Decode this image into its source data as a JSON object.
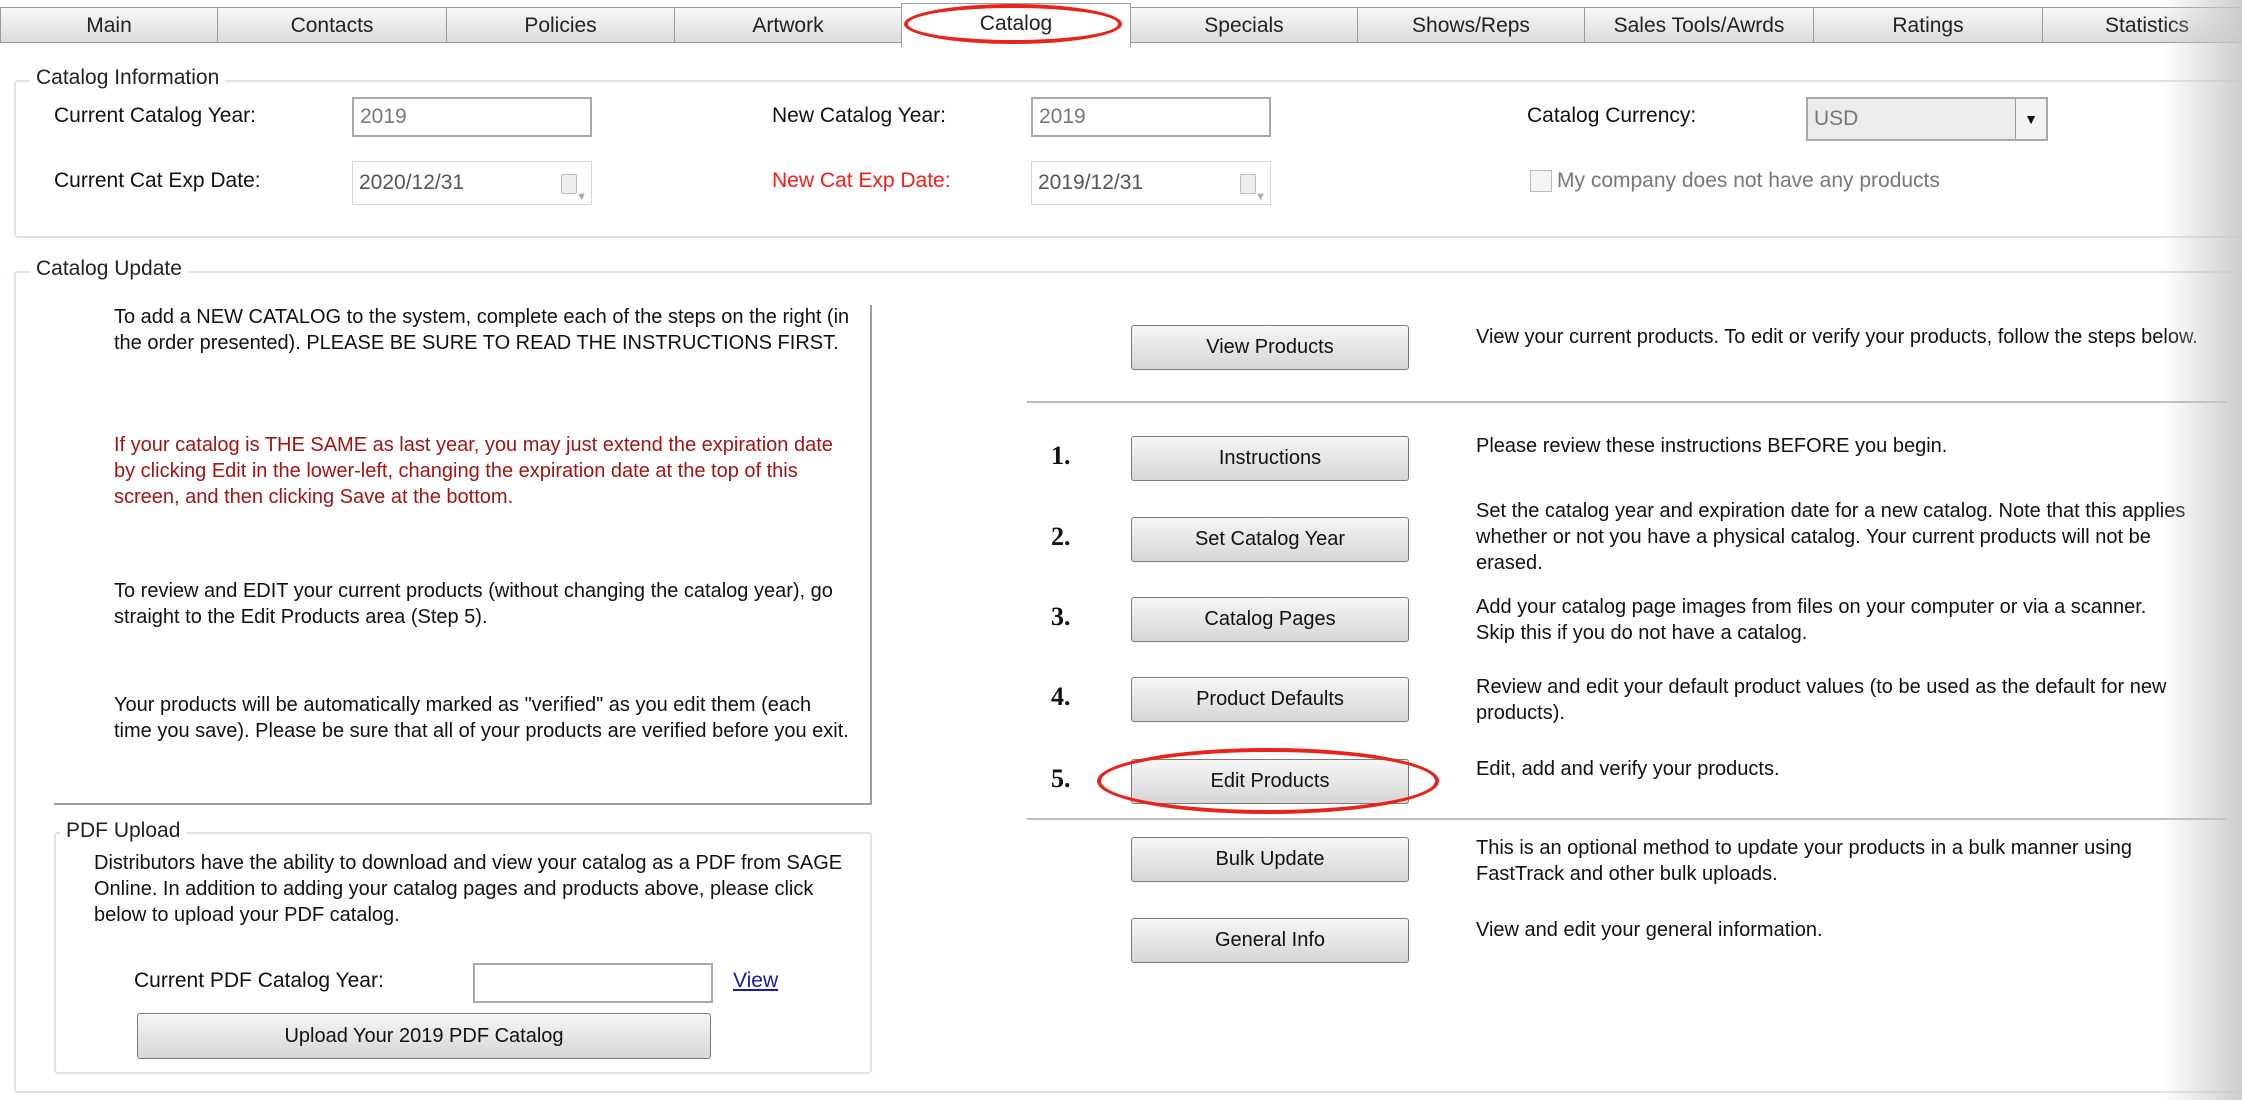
{
  "tabs": [
    {
      "label": "Main"
    },
    {
      "label": "Contacts"
    },
    {
      "label": "Policies"
    },
    {
      "label": "Artwork"
    },
    {
      "label": "Catalog",
      "active": true
    },
    {
      "label": "Specials"
    },
    {
      "label": "Shows/Reps"
    },
    {
      "label": "Sales Tools/Awrds"
    },
    {
      "label": "Ratings"
    },
    {
      "label": "Statistics"
    }
  ],
  "catalog_info": {
    "legend": "Catalog Information",
    "current_year_label": "Current Catalog Year:",
    "current_year_value": "2019",
    "current_exp_label": "Current Cat Exp Date:",
    "current_exp_value": "2020/12/31",
    "new_year_label": "New Catalog Year:",
    "new_year_value": "2019",
    "new_exp_label": "New Cat Exp Date:",
    "new_exp_value": "2019/12/31",
    "currency_label": "Catalog Currency:",
    "currency_value": "USD",
    "no_products_label": "My company does not have any products",
    "no_products_checked": false
  },
  "catalog_update": {
    "legend": "Catalog Update",
    "para1": "To add a NEW CATALOG to the system, complete each of the steps on the right (in the order presented).  PLEASE BE SURE TO READ THE INSTRUCTIONS FIRST.",
    "para2": "If your catalog is THE SAME as last year, you may just extend the expiration date by clicking Edit in the lower-left, changing the expiration date at the top of this screen, and then clicking Save at the bottom.",
    "para3": "To review and EDIT your current products (without changing the catalog year), go straight to the Edit Products area (Step 5).",
    "para4": "Your products will be automatically marked as \"verified\" as you edit them (each time you save).  Please be sure that all of your products are verified before you exit.",
    "view_products": {
      "label": "View Products",
      "desc": "View your current products.  To edit or verify your products, follow the steps below."
    },
    "steps": [
      {
        "num": "1.",
        "label": "Instructions",
        "desc": "Please review these instructions BEFORE you begin."
      },
      {
        "num": "2.",
        "label": "Set Catalog Year",
        "desc": "Set the catalog year and expiration date for a new catalog.  Note that this applies whether or not you have a physical catalog.  Your current products will not be erased."
      },
      {
        "num": "3.",
        "label": "Catalog Pages",
        "desc": "Add your catalog page images from files on your computer or via a scanner. Skip this if you do not have a catalog."
      },
      {
        "num": "4.",
        "label": "Product Defaults",
        "desc": "Review and edit your default product values (to be used as the default for new products)."
      },
      {
        "num": "5.",
        "label": "Edit Products",
        "desc": "Edit, add and verify your products."
      }
    ],
    "bulk_update": {
      "label": "Bulk Update",
      "desc": "This is an optional method to update your products in a bulk manner using FastTrack and other bulk uploads."
    },
    "general_info": {
      "label": "General Info",
      "desc": "View and edit your general information."
    }
  },
  "pdf_upload": {
    "legend": "PDF Upload",
    "desc": "Distributors have the ability to download and view your catalog as a PDF from SAGE Online.  In addition to adding your catalog pages and products above, please click below to upload your PDF catalog.",
    "year_label": "Current PDF Catalog Year:",
    "year_value": "",
    "view_link": "View",
    "upload_button": "Upload Your 2019 PDF Catalog"
  },
  "colors": {
    "annotation": "#e8231a",
    "warning_text": "#a31515",
    "required_label": "#ff1a1a",
    "link": "#1a1aa6"
  }
}
